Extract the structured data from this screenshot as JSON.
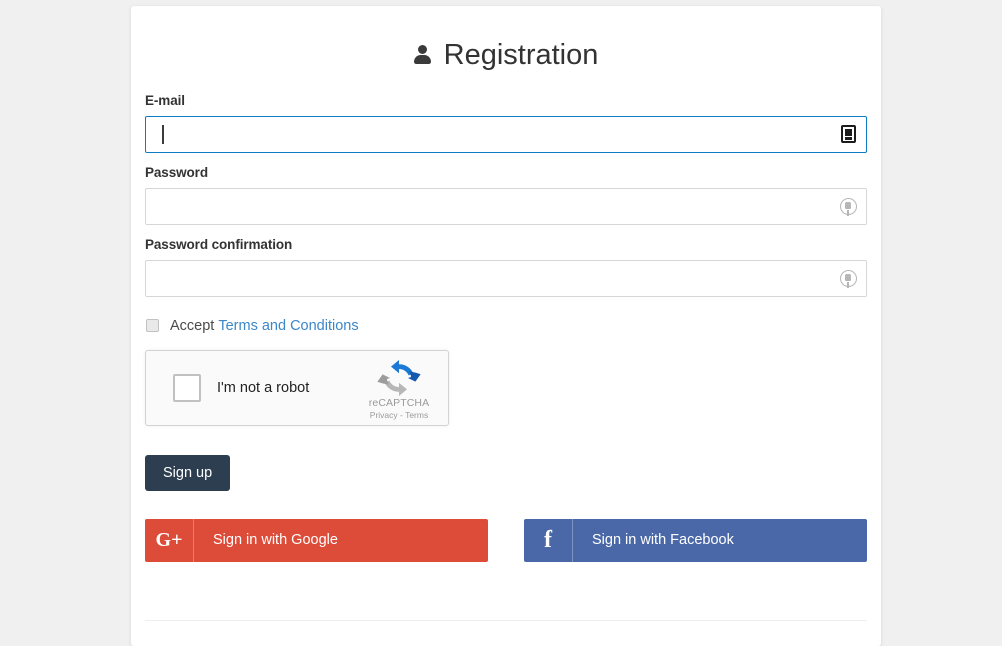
{
  "page": {
    "background_color": "#f0f0f0",
    "card_background": "#ffffff"
  },
  "header": {
    "title": "Registration",
    "icon": "user-icon"
  },
  "form": {
    "fields": [
      {
        "label": "E-mail",
        "value": "",
        "placeholder": "",
        "focused": true,
        "icon": "contact-card-icon"
      },
      {
        "label": "Password",
        "value": "",
        "placeholder": "",
        "focused": false,
        "icon": "key-icon"
      },
      {
        "label": "Password confirmation",
        "value": "",
        "placeholder": "",
        "focused": false,
        "icon": "key-icon"
      }
    ],
    "accept": {
      "checked": false,
      "text": "Accept",
      "link_text": "Terms and Conditions",
      "link_color": "#3b87c8"
    },
    "recaptcha": {
      "label": "I'm not a robot",
      "checked": false,
      "brand_name": "reCAPTCHA",
      "legal": "Privacy - Terms",
      "logo": "recaptcha-logo"
    },
    "submit": {
      "label": "Sign up",
      "color": "#2c3e50"
    },
    "social": [
      {
        "label": "Sign in with Google",
        "icon": "google-plus-icon",
        "glyph": "G+",
        "color": "#dd4b39"
      },
      {
        "label": "Sign in with Facebook",
        "icon": "facebook-icon",
        "glyph": "f",
        "color": "#4a68a8"
      }
    ]
  }
}
